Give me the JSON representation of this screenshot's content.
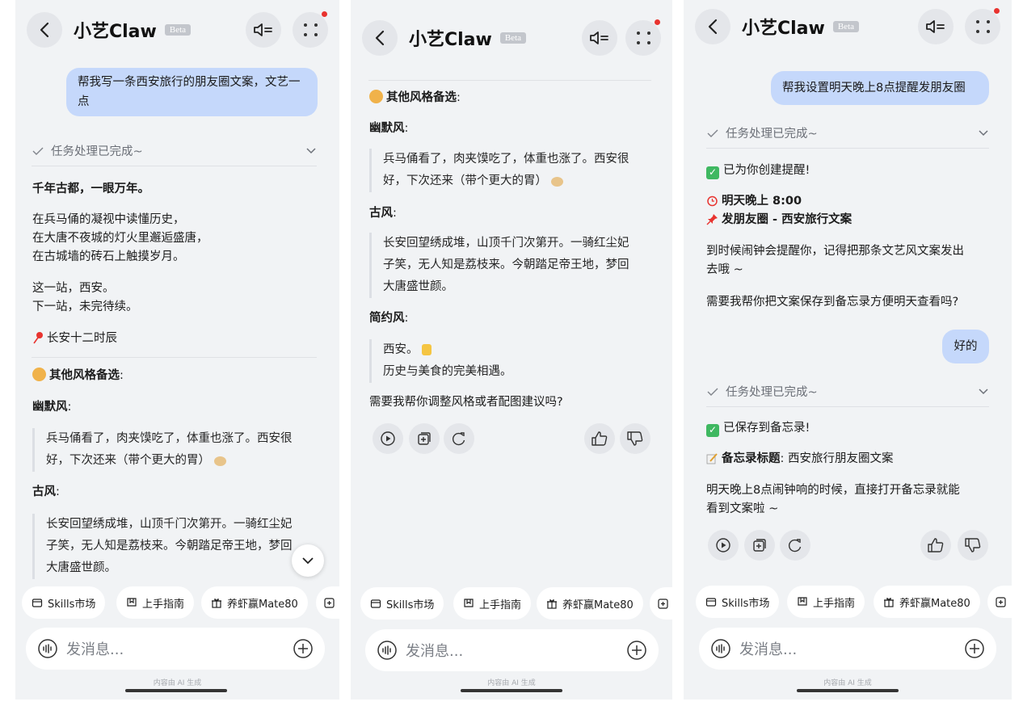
{
  "app": {
    "title": "小艺Claw",
    "beta": "Beta",
    "input_placeholder": "发消息...",
    "ai_note": "内容由 AI 生成",
    "accent_color": "#c5d8fb"
  },
  "chips": [
    "Skills市场",
    "上手指南",
    "养虾赢Mate80"
  ],
  "screen1": {
    "user_message": "帮我写一条西安旅行的朋友圈文案，文艺一点",
    "task_status": "任务处理已完成~",
    "headline": "千年古都，一眼万年。",
    "stanza1": [
      "在兵马俑的凝视中读懂历史，",
      "在大唐不夜城的灯火里邂逅盛唐，",
      "在古城墙的砖石上触摸岁月。"
    ],
    "stanza2": [
      "这一站，西安。",
      "下一站，未完待续。"
    ],
    "tag": "长安十二时辰",
    "other_styles": "其他风格备选",
    "humor_label": "幽默风",
    "humor_text": [
      "兵马俑看了，肉夹馍吃了，体重也涨了。西安很",
      "好，下次还来（带个更大的胃）"
    ],
    "ancient_label": "古风",
    "ancient_text": [
      "长安回望绣成堆，山顶千门次第开。一骑红尘妃",
      "子笑，无人知是荔枝来。今朝踏足帝王地，梦回",
      "大唐盛世颜。"
    ]
  },
  "screen2": {
    "other_styles": "其他风格备选",
    "humor_label": "幽默风",
    "humor_text": [
      "兵马俑看了，肉夹馍吃了，体重也涨了。西安很",
      "好，下次还来（带个更大的胃）"
    ],
    "ancient_label": "古风",
    "ancient_text": [
      "长安回望绣成堆，山顶千门次第开。一骑红尘妃",
      "子笑，无人知是荔枝来。今朝踏足帝王地，梦回",
      "大唐盛世颜。"
    ],
    "simple_label": "简约风",
    "simple_text": [
      "西安。",
      "历史与美食的完美相遇。"
    ],
    "followup": "需要我帮你调整风格或者配图建议吗?"
  },
  "screen3": {
    "user_message_1": "帮我设置明天晚上8点提醒发朋友圈",
    "task_status_1": "任务处理已完成~",
    "created": "已为你创建提醒!",
    "reminder_time": "明天晚上 8:00",
    "reminder_title": "发朋友圈 - 西安旅行文案",
    "alarm_note": [
      "到时候闹钟会提醒你，记得把那条文艺风文案发出",
      "去哦 ~"
    ],
    "question": "需要我帮你把文案保存到备忘录方便明天查看吗?",
    "user_message_2": "好的",
    "task_status_2": "任务处理已完成~",
    "saved": "已保存到备忘录!",
    "memo_label": "备忘录标题",
    "memo_title": "西安旅行朋友圈文案",
    "memo_note": [
      "明天晚上8点闹钟响的时候，直接打开备忘录就能",
      "看到文案啦 ~"
    ]
  }
}
